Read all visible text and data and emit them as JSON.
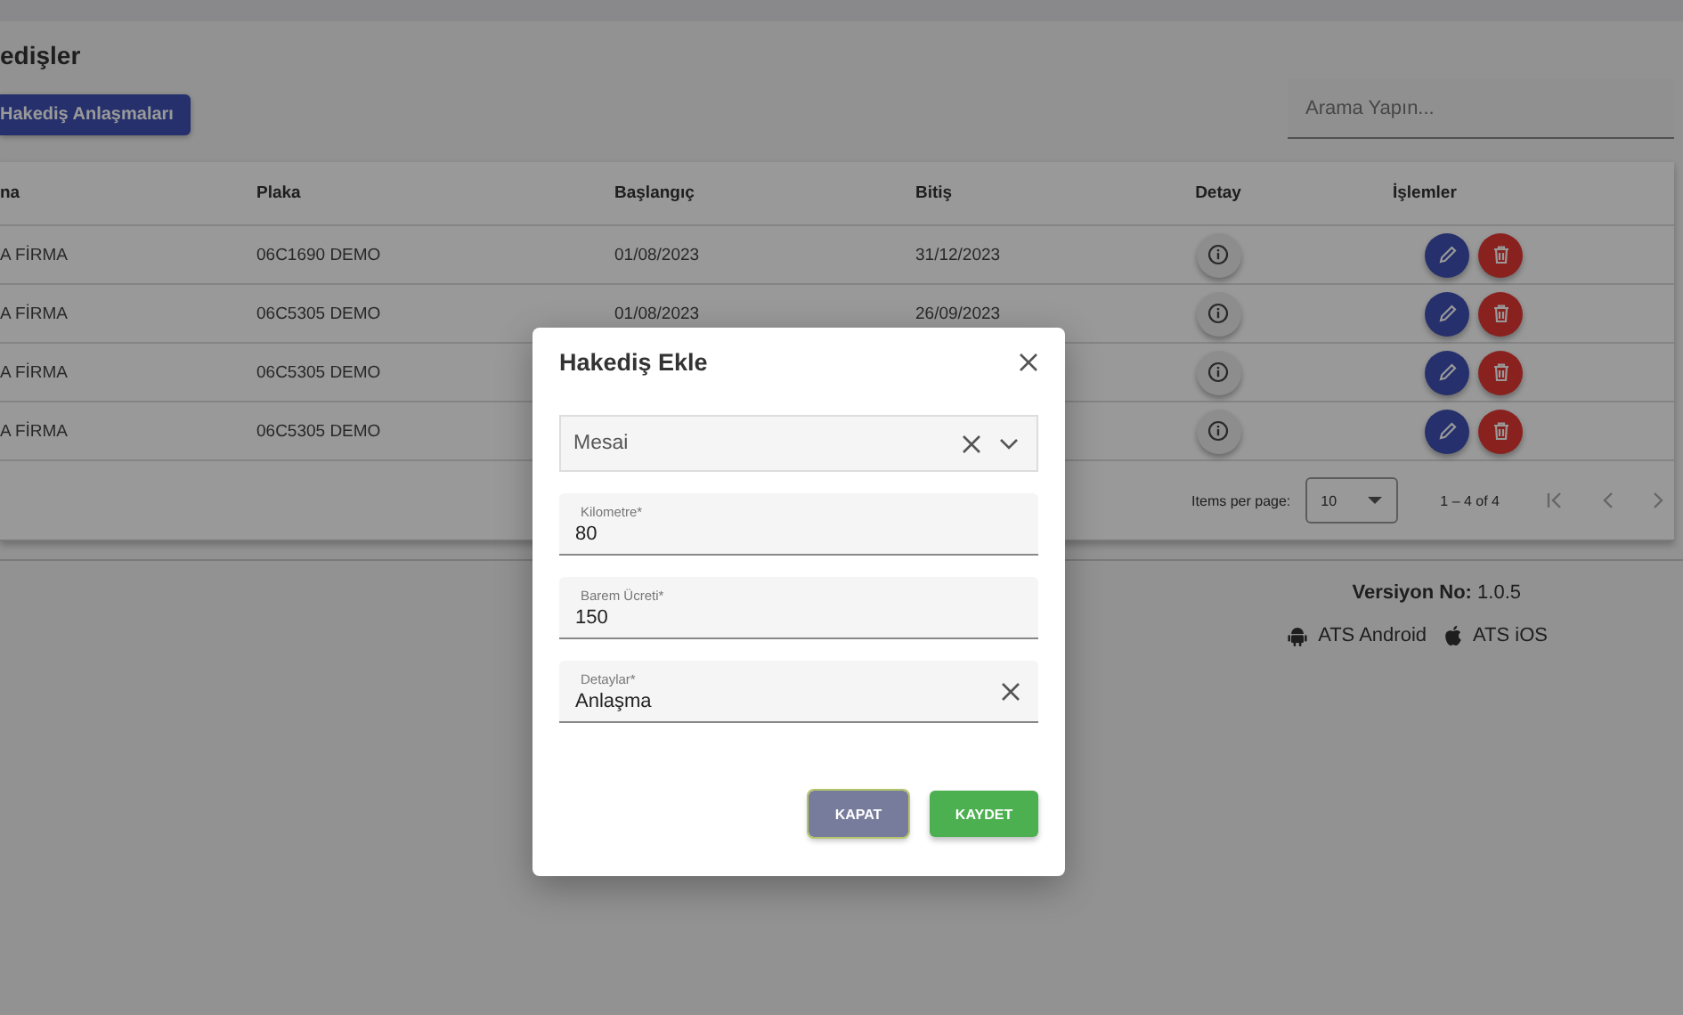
{
  "page": {
    "title": "edişler",
    "agreements_button": "Hakediş Anlaşmaları",
    "search": {
      "placeholder": "Arama Yapın..."
    }
  },
  "table": {
    "columns": [
      "na",
      "Plaka",
      "Başlangıç",
      "Bitiş",
      "Detay",
      "İşlemler"
    ],
    "rows": [
      {
        "column_1": "A FİRMA",
        "plaka": "06C1690 DEMO",
        "start": "01/08/2023",
        "end": "31/12/2023"
      },
      {
        "column_1": "A FİRMA",
        "plaka": "06C5305 DEMO",
        "start": "01/08/2023",
        "end": "26/09/2023"
      },
      {
        "column_1": "A FİRMA",
        "plaka": "06C5305 DEMO"
      },
      {
        "column_1": "A FİRMA",
        "plaka": "06C5305 DEMO"
      }
    ]
  },
  "paginator": {
    "label": "Items per page:",
    "page_size": "10",
    "range": "1 – 4 of 4"
  },
  "footer": {
    "version_label": "Versiyon No:",
    "version": "1.0.5",
    "links": [
      {
        "kind": "android",
        "label": "ATS Android"
      },
      {
        "kind": "apple",
        "label": "ATS iOS"
      }
    ]
  },
  "dialog": {
    "title": "Hakediş Ekle",
    "select": {
      "value": "Mesai"
    },
    "fields": [
      {
        "label": "Kilometre*",
        "value": "80",
        "clearable": false
      },
      {
        "label": "Barem Ücreti*",
        "value": "150",
        "clearable": false
      },
      {
        "label": "Detaylar*",
        "value": "Anlaşma",
        "clearable": true
      }
    ],
    "buttons": [
      {
        "label": "KAPAT",
        "kind": "secondary"
      },
      {
        "label": "KAYDET",
        "kind": "primary"
      }
    ]
  }
}
